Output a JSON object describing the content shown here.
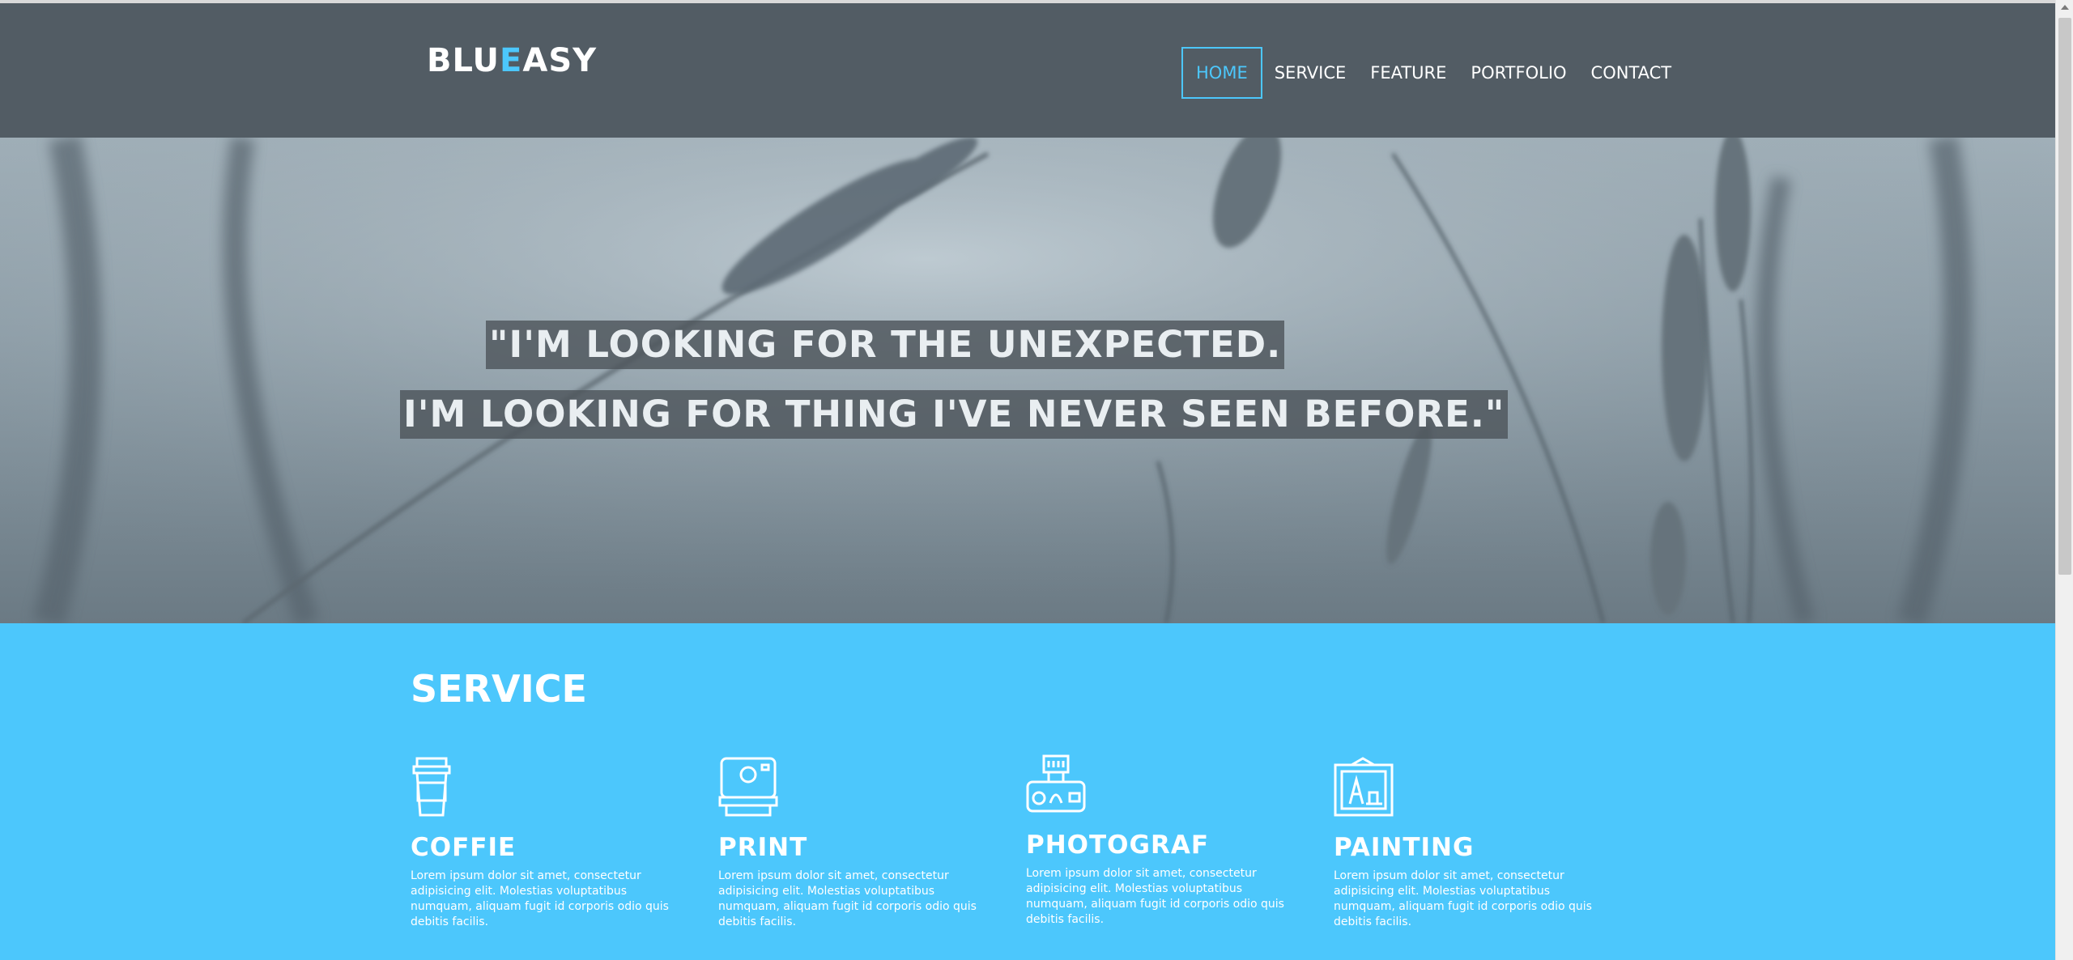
{
  "header": {
    "logo": {
      "part1": "BLU",
      "accent": "E",
      "part2": "ASY"
    },
    "nav": [
      {
        "label": "HOME",
        "active": true
      },
      {
        "label": "SERVICE",
        "active": false
      },
      {
        "label": "FEATURE",
        "active": false
      },
      {
        "label": "PORTFOLIO",
        "active": false
      },
      {
        "label": "CONTACT",
        "active": false
      }
    ]
  },
  "hero": {
    "quote_line1": "\"I'M LOOKING FOR THE UNEXPECTED.",
    "quote_line2": "I'M LOOKING FOR THING I'VE NEVER SEEN BEFORE.\""
  },
  "service": {
    "title": "SERVICE",
    "items": [
      {
        "icon": "coffee-cup-icon",
        "title": "COFFIE",
        "text": "Lorem ipsum dolor sit amet, consectetur adipisicing elit. Molestias voluptatibus numquam, aliquam fugit id corporis odio quis debitis facilis."
      },
      {
        "icon": "polaroid-camera-icon",
        "title": "PRINT",
        "text": "Lorem ipsum dolor sit amet, consectetur adipisicing elit. Molestias voluptatibus numquam, aliquam fugit id corporis odio quis debitis facilis."
      },
      {
        "icon": "camera-flash-icon",
        "title": "PHOTOGRAF",
        "text": "Lorem ipsum dolor sit amet, consectetur adipisicing elit. Molestias voluptatibus numquam, aliquam fugit id corporis odio quis debitis facilis."
      },
      {
        "icon": "painting-frame-icon",
        "title": "PAINTING",
        "text": "Lorem ipsum dolor sit amet, consectetur adipisicing elit. Molestias voluptatibus numquam, aliquam fugit id corporis odio quis debitis facilis."
      }
    ]
  },
  "colors": {
    "accent": "#4cc7fc",
    "header_bg": "#525c64",
    "service_bg": "#4cc7fc"
  }
}
